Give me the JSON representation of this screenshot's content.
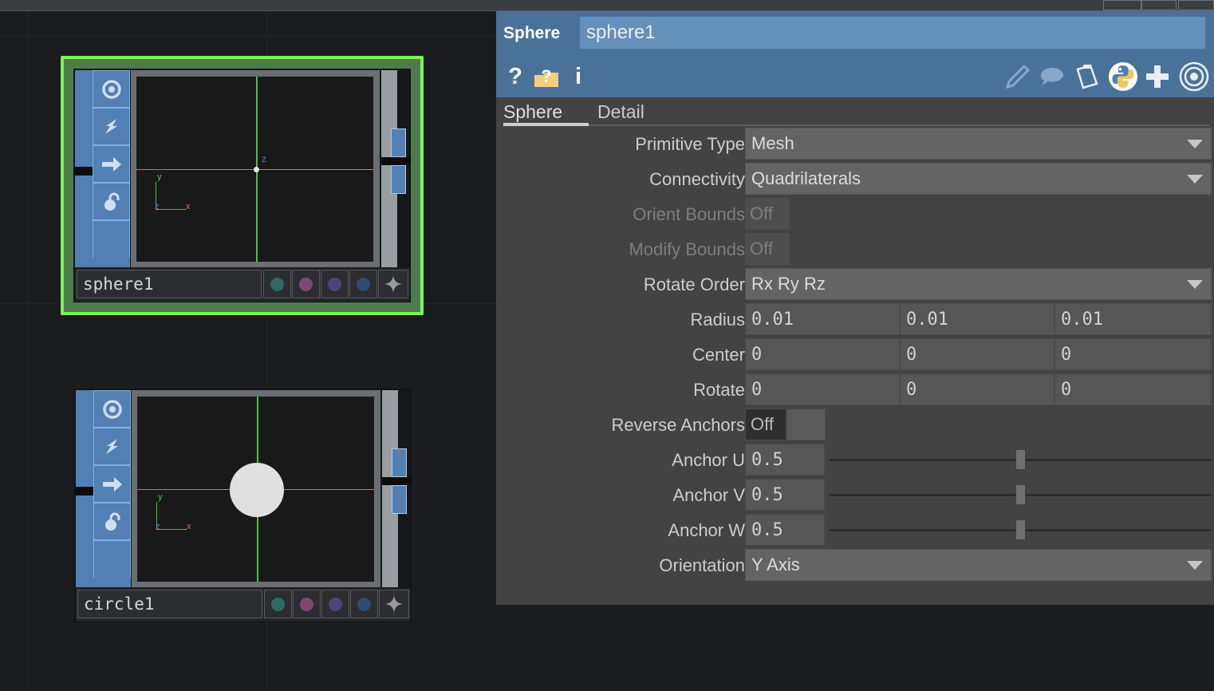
{
  "window": {
    "top_buttons": [
      "",
      "",
      ""
    ]
  },
  "network_editor": {
    "name": "network-editor",
    "background_color": "#1a1c20",
    "nodes": [
      {
        "id": "sphere1",
        "label": "sphere1",
        "selected": true,
        "selection_color": "#7ef05d",
        "flags": [
          {
            "name": "display-flag-icon",
            "glyph": "target"
          },
          {
            "name": "render-flag-icon",
            "glyph": "bolt"
          },
          {
            "name": "template-flag-icon",
            "glyph": "arrow-right"
          },
          {
            "name": "lock-flag-icon",
            "glyph": "padlock"
          },
          {
            "name": "blank-flag",
            "glyph": ""
          }
        ],
        "viewport": {
          "axis_labels": {
            "z_center": "z",
            "gnomon_y": "y",
            "gnomon_x": "x",
            "gnomon_z": "z"
          },
          "geometry": "point-only"
        },
        "color_chips": [
          "#2d6a62",
          "#7c4a71",
          "#4b4475",
          "#2f4a72"
        ],
        "star_chip": "star-icon"
      },
      {
        "id": "circle1",
        "label": "circle1",
        "selected": false,
        "flags": [
          {
            "name": "display-flag-icon",
            "glyph": "target"
          },
          {
            "name": "render-flag-icon",
            "glyph": "bolt"
          },
          {
            "name": "template-flag-icon",
            "glyph": "arrow-right"
          },
          {
            "name": "lock-flag-icon",
            "glyph": "padlock"
          },
          {
            "name": "blank-flag",
            "glyph": ""
          }
        ],
        "viewport": {
          "axis_labels": {
            "gnomon_y": "y",
            "gnomon_x": "x",
            "gnomon_z": "z"
          },
          "geometry": "filled-circle"
        },
        "color_chips": [
          "#2d6a62",
          "#7c4a71",
          "#4b4475",
          "#2f4a72"
        ],
        "star_chip": "star-icon"
      }
    ]
  },
  "parameter_panel": {
    "name": "parameter-panel",
    "header": {
      "node_type": "Sphere",
      "node_name": "sphere1",
      "accent_color": "#4a7299",
      "field_color": "#6590bb"
    },
    "toolbar_left": [
      {
        "name": "help-icon",
        "glyph": "?"
      },
      {
        "name": "help-folder-icon",
        "glyph": "?"
      },
      {
        "name": "info-icon",
        "glyph": "i"
      }
    ],
    "toolbar_right": [
      {
        "name": "edit-pencil-icon",
        "glyph": "pencil"
      },
      {
        "name": "comment-icon",
        "glyph": "speech-bubble"
      },
      {
        "name": "clipboard-icon",
        "glyph": "clipboard"
      },
      {
        "name": "python-icon",
        "glyph": "python"
      },
      {
        "name": "add-icon",
        "glyph": "plus"
      },
      {
        "name": "target-icon",
        "glyph": "concentric-circles"
      }
    ],
    "tabs": [
      {
        "label": "Sphere",
        "active": true
      },
      {
        "label": "Detail",
        "active": false
      }
    ],
    "parameters": [
      {
        "label": "Primitive Type",
        "type": "combo",
        "value": "Mesh",
        "disabled": false
      },
      {
        "label": "Connectivity",
        "type": "combo",
        "value": "Quadrilaterals",
        "disabled": false
      },
      {
        "label": "Orient Bounds",
        "type": "toggle-disabled",
        "value": "Off",
        "disabled": true
      },
      {
        "label": "Modify Bounds",
        "type": "toggle-disabled",
        "value": "Off",
        "disabled": true
      },
      {
        "label": "Rotate Order",
        "type": "combo",
        "value": "Rx Ry Rz",
        "disabled": false
      },
      {
        "label": "Radius",
        "type": "vector3",
        "values": [
          "0.01",
          "0.01",
          "0.01"
        ],
        "disabled": false
      },
      {
        "label": "Center",
        "type": "vector3",
        "values": [
          "0",
          "0",
          "0"
        ],
        "disabled": false
      },
      {
        "label": "Rotate",
        "type": "vector3",
        "values": [
          "0",
          "0",
          "0"
        ],
        "disabled": false
      },
      {
        "label": "Reverse Anchors",
        "type": "toggle",
        "value": "Off",
        "disabled": false
      },
      {
        "label": "Anchor U",
        "type": "slider",
        "value": "0.5",
        "slider_pos": 0.5,
        "disabled": false
      },
      {
        "label": "Anchor V",
        "type": "slider",
        "value": "0.5",
        "slider_pos": 0.5,
        "disabled": false
      },
      {
        "label": "Anchor W",
        "type": "slider",
        "value": "0.5",
        "slider_pos": 0.5,
        "disabled": false
      },
      {
        "label": "Orientation",
        "type": "combo",
        "value": "Y Axis",
        "disabled": false
      }
    ]
  }
}
